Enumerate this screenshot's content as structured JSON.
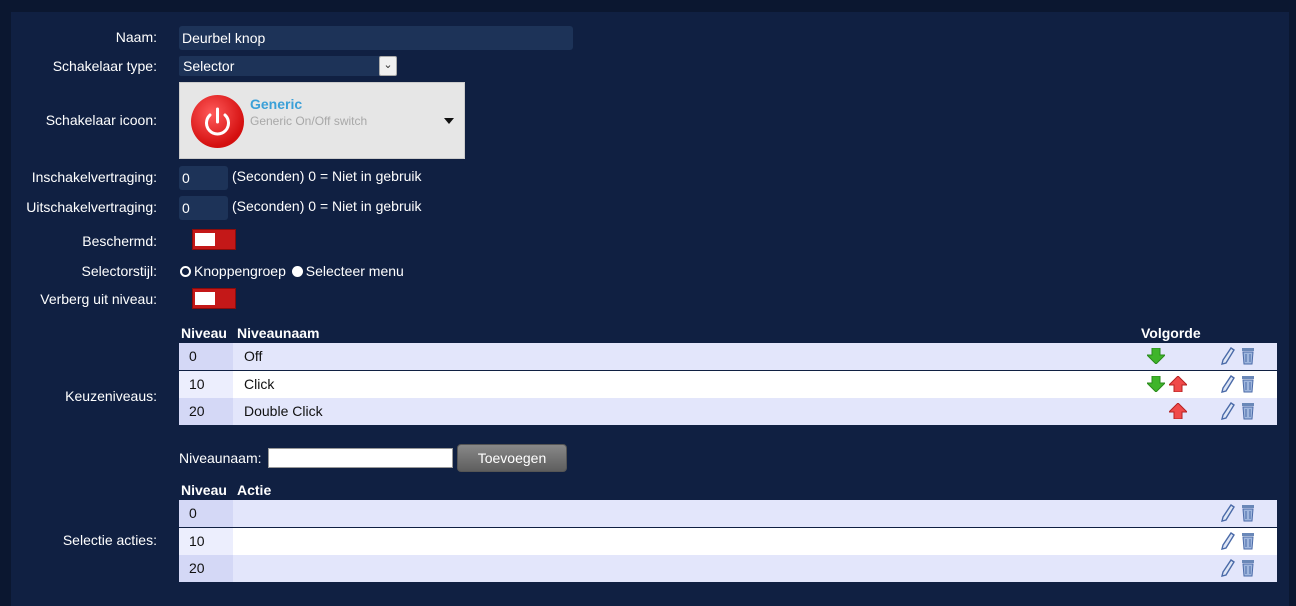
{
  "labels": {
    "naam": "Naam:",
    "schakelaar_type": "Schakelaar type:",
    "schakelaar_icoon": "Schakelaar icoon:",
    "inschakelvertraging": "Inschakelvertraging:",
    "uitschakelvertraging": "Uitschakelvertraging:",
    "beschermd": "Beschermd:",
    "selectorstijl": "Selectorstijl:",
    "verberg_uit_niveau": "Verberg uit niveau:",
    "keuzeniveaus": "Keuzeniveaus:",
    "selectie_acties": "Selectie acties:"
  },
  "fields": {
    "naam_value": "Deurbel knop",
    "schakelaar_type_value": "Selector",
    "icon_title": "Generic",
    "icon_subtitle": "Generic On/Off switch",
    "in_delay_value": "0",
    "out_delay_value": "0",
    "delay_hint": "(Seconden) 0 = Niet in gebruik",
    "beschermd_on": false,
    "verberg_uit_niveau_on": false,
    "selector_style_options": [
      "Knoppengroep",
      "Selecteer menu"
    ],
    "selector_style_selected": "Selecteer menu"
  },
  "levels_table": {
    "headers": [
      "Niveau",
      "Niveaunaam",
      "Volgorde"
    ],
    "rows": [
      {
        "niveau": "0",
        "name": "Off",
        "down": true,
        "up": false
      },
      {
        "niveau": "10",
        "name": "Click",
        "down": true,
        "up": true
      },
      {
        "niveau": "20",
        "name": "Double Click",
        "down": false,
        "up": true
      }
    ]
  },
  "add_level": {
    "label": "Niveaunaam:",
    "button": "Toevoegen"
  },
  "actions_table": {
    "headers": [
      "Niveau",
      "Actie"
    ],
    "rows": [
      {
        "niveau": "0",
        "actie": ""
      },
      {
        "niveau": "10",
        "actie": ""
      },
      {
        "niveau": "20",
        "actie": ""
      }
    ]
  },
  "icons": [
    "power-icon",
    "arrow-down-icon",
    "arrow-up-icon",
    "edit-pencil-icon",
    "trash-icon",
    "dropdown-caret-icon"
  ],
  "colors": {
    "background": "#0b1730",
    "panel": "#102042",
    "toggle_off": "#c41818",
    "icon_title": "#3ba0d8"
  }
}
